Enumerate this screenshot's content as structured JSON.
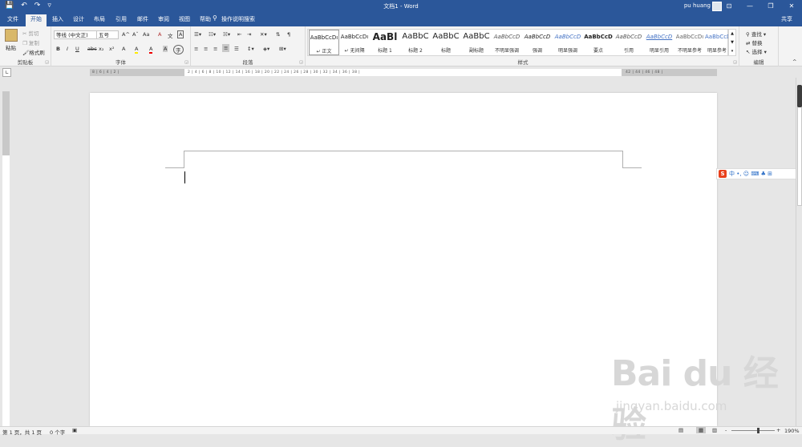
{
  "titlebar": {
    "doc_title": "文档1 - Word",
    "user": "pu huang",
    "qat": {
      "save_icon": "💾",
      "undo_icon": "↶",
      "redo_icon": "↷",
      "more_icon": "▿"
    },
    "min_icon": "—",
    "restore_icon": "❐",
    "close_icon": "✕",
    "ribbon_opt_icon": "⊡"
  },
  "tabs": [
    "文件",
    "开始",
    "插入",
    "设计",
    "布局",
    "引用",
    "邮件",
    "审阅",
    "视图",
    "帮助"
  ],
  "active_tab": "开始",
  "tell_me": "操作说明搜索",
  "share": "共享",
  "clipboard": {
    "paste": "粘贴",
    "cut": "剪切",
    "copy": "复制",
    "format_painter": "格式刷",
    "label": "剪贴板"
  },
  "font": {
    "name": "等线 (中文正)",
    "size": "五号",
    "grow": "A^",
    "shrink": "Aˇ",
    "case": "Aa",
    "bold": "B",
    "italic": "I",
    "underline": "U",
    "strike": "abc",
    "sub": "x₂",
    "sup": "x²",
    "highlight": "A",
    "color": "A",
    "label": "字体"
  },
  "paragraph": {
    "label": "段落"
  },
  "styles": {
    "label": "样式",
    "items": [
      {
        "preview": "AaBbCcDı",
        "name": "↵ 正文"
      },
      {
        "preview": "AaBbCcDı",
        "name": "↵ 无间隔"
      },
      {
        "preview": "AaBl",
        "name": "标题 1"
      },
      {
        "preview": "AaBbC",
        "name": "标题 2"
      },
      {
        "preview": "AaBbC",
        "name": "标题"
      },
      {
        "preview": "AaBbC",
        "name": "副标题"
      },
      {
        "preview": "AaBbCcD",
        "name": "不明显强调"
      },
      {
        "preview": "AaBbCcD",
        "name": "强调"
      },
      {
        "preview": "AaBbCcD",
        "name": "明显强调"
      },
      {
        "preview": "AaBbCcD",
        "name": "要点"
      },
      {
        "preview": "AaBbCcD",
        "name": "引用"
      },
      {
        "preview": "AaBbCcD",
        "name": "明显引用"
      },
      {
        "preview": "AaBbCcDı",
        "name": "不明显参考"
      },
      {
        "preview": "AaBbCcDı",
        "name": "明显参考"
      }
    ]
  },
  "editing": {
    "find": "查找",
    "replace": "替换",
    "select": "选择",
    "label": "编辑"
  },
  "ruler": {
    "left_numbers": "8 | 6 | 4 | 2 |",
    "main_numbers": "2 | 4 | 6 | 8 | 10 | 12 | 14 | 16 | 18 | 20 | 22 | 24 | 26 | 28 | 30 | 32 | 34 | 36 | 38 |",
    "right_numbers": "42 | 44 | 46 | 48 |"
  },
  "ime": {
    "logo": "S",
    "mode": "中 •, ☺ ⌨ ♣ ⊞"
  },
  "status": {
    "page": "第 1 页，共 1 页",
    "words": "0 个字",
    "zoom": "190%",
    "zoom_minus": "-",
    "zoom_plus": "+"
  },
  "watermark": {
    "brand": "Bai du 经验",
    "url": "jingyan.baidu.com"
  }
}
